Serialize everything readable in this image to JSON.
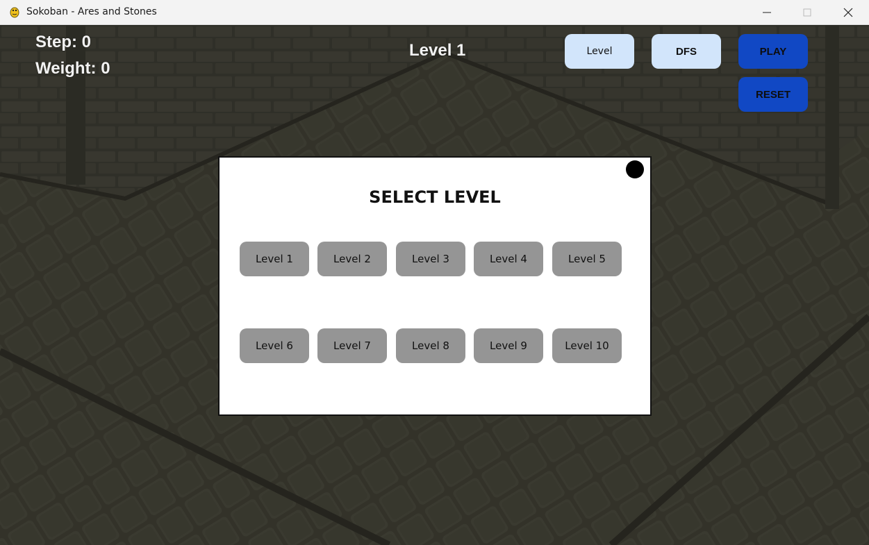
{
  "window": {
    "title": "Sokoban - Ares and Stones"
  },
  "hud": {
    "step": "Step: 0",
    "weight": "Weight: 0",
    "level_title": "Level 1"
  },
  "toolbar": {
    "level_label": "Level",
    "dfs_label": "DFS",
    "play_label": "PLAY",
    "reset_label": "RESET"
  },
  "modal": {
    "title": "SELECT LEVEL",
    "levels": [
      "Level 1",
      "Level 2",
      "Level 3",
      "Level 4",
      "Level 5",
      "Level 6",
      "Level 7",
      "Level 8",
      "Level 9",
      "Level 10"
    ]
  },
  "colors": {
    "light_button": "#d2e5fb",
    "primary_button": "#1148c4",
    "level_button": "#959595",
    "backdrop": "#3b3a32"
  },
  "icons": {
    "app": "pygame-snake-icon",
    "minimize": "minimize-icon",
    "maximize": "maximize-icon",
    "close": "close-icon",
    "modal_close": "close-dot-icon"
  }
}
